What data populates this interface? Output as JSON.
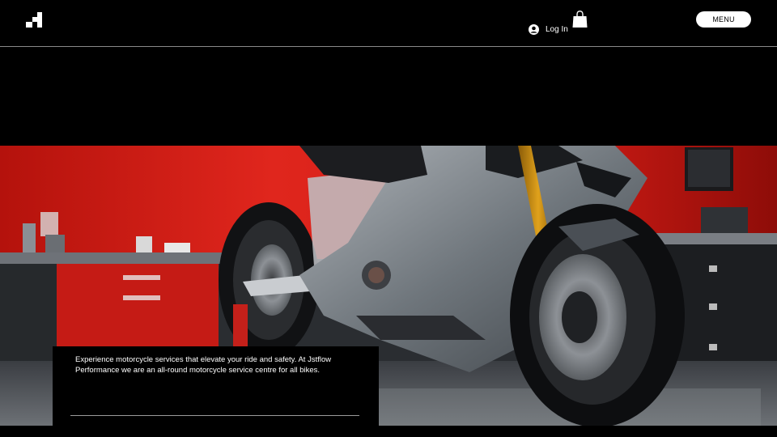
{
  "header": {
    "logo_icon": "pixel-stairs-logo",
    "login_label": "Log In",
    "login_icon": "user-avatar-icon",
    "cart_icon": "shopping-bag-icon",
    "menu_label": "MENU"
  },
  "hero": {
    "image": "motorcycle-in-red-garage",
    "accent_color": "#d7261e"
  },
  "info": {
    "text": "Experience motorcycle services that elevate your ride and safety. At Jstflow Performance we are an all-round motorcycle service centre for all bikes."
  }
}
